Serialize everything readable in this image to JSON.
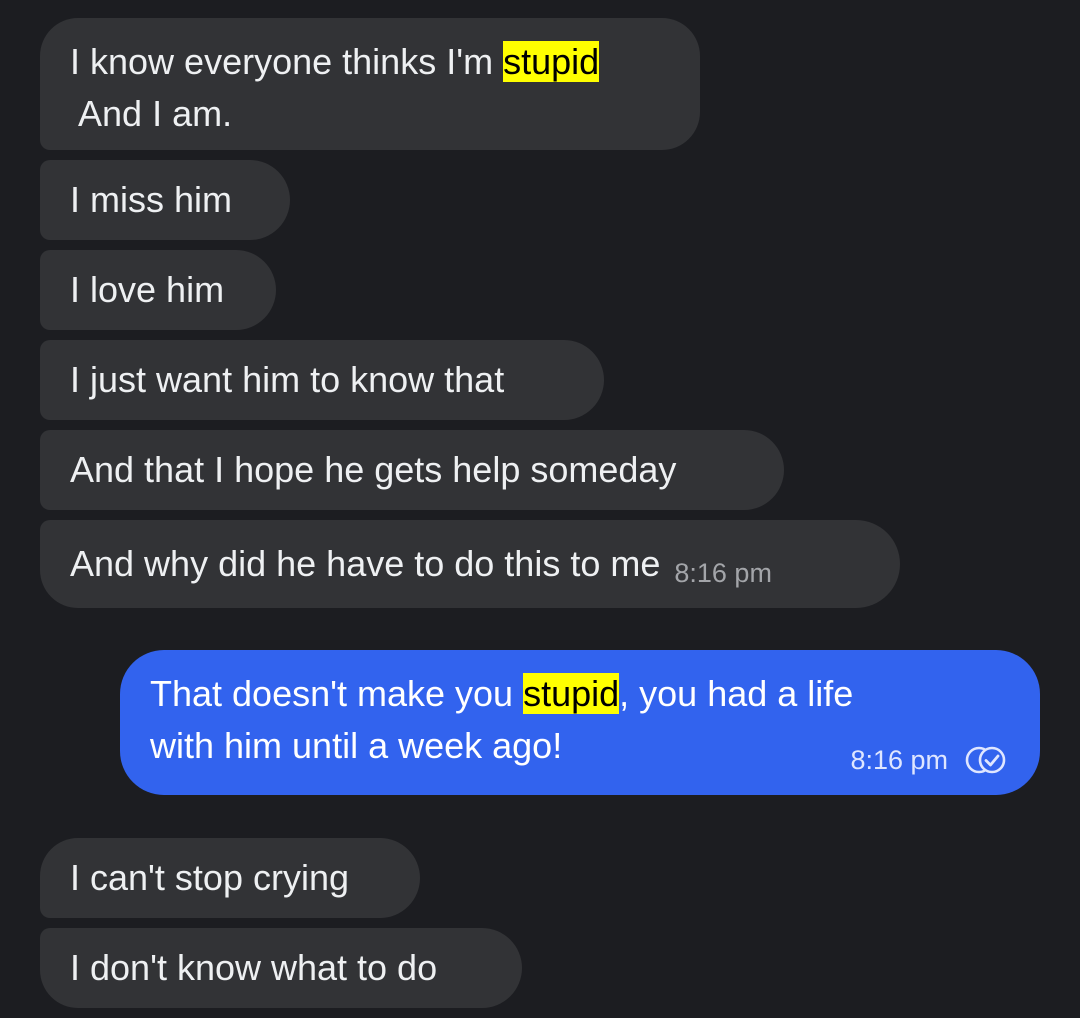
{
  "messages": [
    {
      "line1_before": "I know everyone thinks I'm ",
      "highlight": "stupid",
      "line2": " And I am."
    },
    {
      "text": "I miss him"
    },
    {
      "text": "I love him"
    },
    {
      "text": "I just want him to know that"
    },
    {
      "text": "And that I hope he gets help someday"
    },
    {
      "text": "And why did he have to do this to me",
      "time": "8:16 pm"
    },
    {
      "before": "That doesn't make you ",
      "highlight": "stupid",
      "after": ", you had a life",
      "line2": "with him until a week ago!",
      "time": "8:16 pm",
      "status_icon": "double-check-read-icon"
    },
    {
      "text": "I can't stop crying"
    },
    {
      "text": "I don't know what to do"
    }
  ],
  "colors": {
    "background": "#1c1d21",
    "incoming_bubble": "#323336",
    "outgoing_bubble": "#3263ee",
    "highlight": "#ffff00"
  }
}
